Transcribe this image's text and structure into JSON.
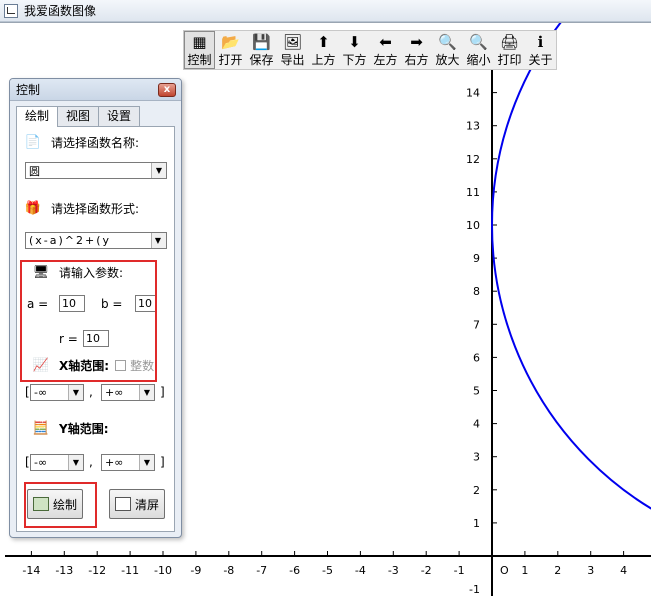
{
  "window": {
    "title": "我爱函数图像"
  },
  "toolbar": {
    "buttons": [
      {
        "label": "控制",
        "icon": "control-panel-icon",
        "glyph": "▦"
      },
      {
        "label": "打开",
        "icon": "open-folder-icon",
        "glyph": "📂"
      },
      {
        "label": "保存",
        "icon": "save-disk-icon",
        "glyph": "💾"
      },
      {
        "label": "导出",
        "icon": "export-image-icon",
        "glyph": "🖼"
      },
      {
        "label": "上方",
        "icon": "arrow-up-icon",
        "glyph": "⬆"
      },
      {
        "label": "下方",
        "icon": "arrow-down-icon",
        "glyph": "⬇"
      },
      {
        "label": "左方",
        "icon": "arrow-left-icon",
        "glyph": "⬅"
      },
      {
        "label": "右方",
        "icon": "arrow-right-icon",
        "glyph": "➡"
      },
      {
        "label": "放大",
        "icon": "zoom-in-icon",
        "glyph": "🔍"
      },
      {
        "label": "缩小",
        "icon": "zoom-out-icon",
        "glyph": "🔍"
      },
      {
        "label": "打印",
        "icon": "printer-icon",
        "glyph": "🖨"
      },
      {
        "label": "关于",
        "icon": "info-icon",
        "glyph": "ℹ"
      }
    ]
  },
  "panel": {
    "title": "控制",
    "close": "x",
    "tabs": [
      "绘制",
      "视图",
      "设置"
    ],
    "name_prompt": "请选择函数名称:",
    "name_value": "圆",
    "form_prompt": "请选择函数形式:",
    "form_value": "(x-a)^2+(y",
    "params_prompt": "请输入参数:",
    "param_a_label": "a =",
    "param_a": "10",
    "param_b_label": "b =",
    "param_b": "10",
    "param_r_label": "r =",
    "param_r": "10",
    "x_range_label": "X轴范围:",
    "integer_label": "整数",
    "x_min": "-∞",
    "x_max": "+∞",
    "y_range_label": "Y轴范围:",
    "y_min": "-∞",
    "y_max": "+∞",
    "open_bracket": "[",
    "close_bracket": "]",
    "comma": ",",
    "draw_button": "绘制",
    "clear_button": "清屏"
  },
  "chart_data": {
    "type": "line",
    "title": "",
    "xlabel": "",
    "ylabel": "",
    "origin_label": "O",
    "x_ticks": [
      -14,
      -13,
      -12,
      -11,
      -10,
      -9,
      -8,
      -7,
      -6,
      -5,
      -4,
      -3,
      -2,
      -1,
      1,
      2,
      3,
      4
    ],
    "y_ticks": [
      1,
      2,
      3,
      4,
      5,
      6,
      7,
      8,
      9,
      10,
      11,
      12,
      13,
      14
    ],
    "y_ticks_partial": [
      "-1"
    ],
    "xlim": [
      -14.5,
      4.8
    ],
    "ylim": [
      -1.2,
      15.2
    ],
    "grid": false,
    "series": [
      {
        "color": "#0000ee",
        "equation": "(x-10)^2+(y-10)^2=100"
      }
    ]
  }
}
